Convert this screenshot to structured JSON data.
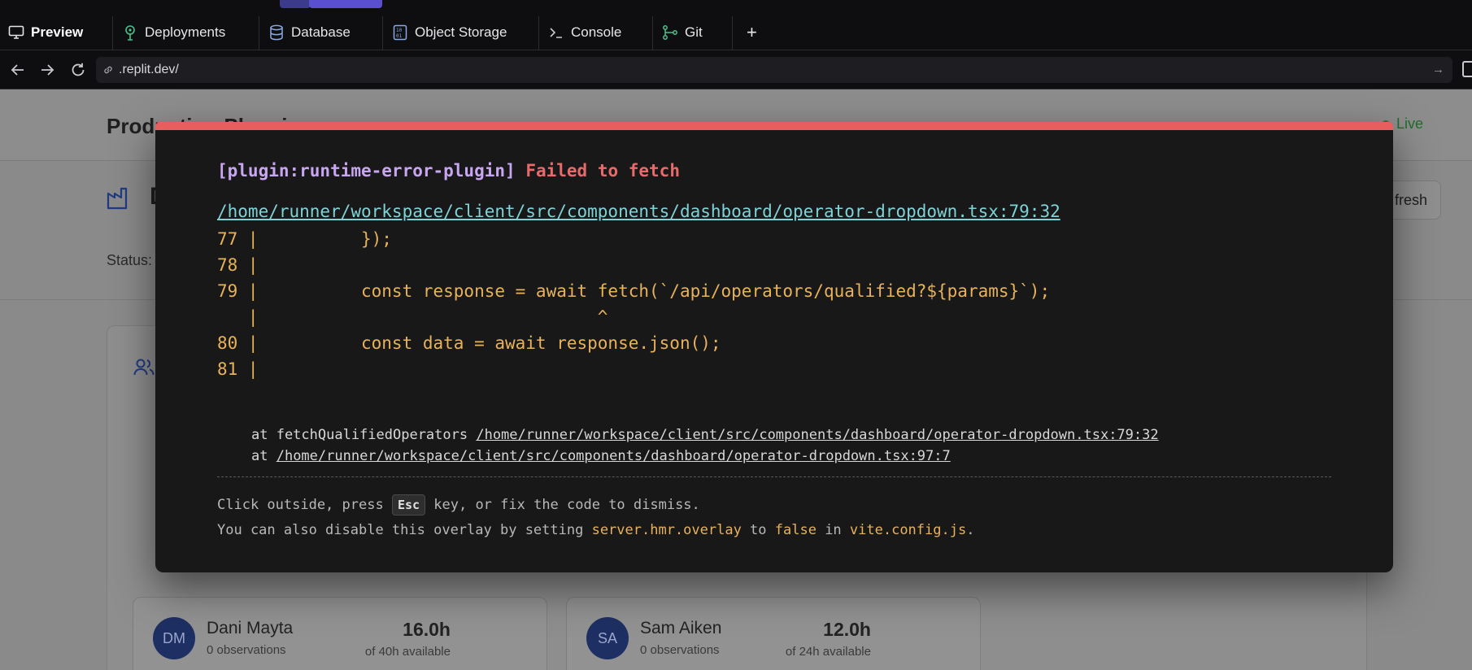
{
  "tabs": [
    {
      "label": "Preview",
      "icon": "monitor-icon",
      "active": true
    },
    {
      "label": "Deployments",
      "icon": "deploy-icon"
    },
    {
      "label": "Database",
      "icon": "database-icon"
    },
    {
      "label": "Object Storage",
      "icon": "storage-icon"
    },
    {
      "label": "Console",
      "icon": "terminal-icon"
    },
    {
      "label": "Git",
      "icon": "git-icon"
    }
  ],
  "add_tab_label": "+",
  "url": ".replit.dev/",
  "app": {
    "brand": "Production Planning",
    "page_title_stub": "D",
    "refresh_label": "fresh",
    "status_label": "Status:",
    "live_label": "Live",
    "operators": [
      {
        "initials": "DM",
        "name": "Dani Mayta",
        "observations": "0 observations",
        "hours": "16.0h",
        "available": "of 40h available"
      },
      {
        "initials": "SA",
        "name": "Sam Aiken",
        "observations": "0 observations",
        "hours": "12.0h",
        "available": "of 24h available"
      }
    ]
  },
  "error": {
    "plugin": "[plugin:runtime-error-plugin]",
    "message": "Failed to fetch",
    "file": "/home/runner/workspace/client/src/components/dashboard/operator-dropdown.tsx:79:32",
    "code_lines": [
      "77 |          });",
      "78 |",
      "79 |          const response = await fetch(`/api/operators/qualified?${params}`);",
      "   |                                 ^",
      "80 |          const data = await response.json();",
      "81 |"
    ],
    "stack": [
      {
        "prefix": "at fetchQualifiedOperators ",
        "link": "/home/runner/workspace/client/src/components/dashboard/operator-dropdown.tsx:79:32"
      },
      {
        "prefix": "at ",
        "link": "/home/runner/workspace/client/src/components/dashboard/operator-dropdown.tsx:97:7"
      }
    ],
    "tip_line1_a": "Click outside, press ",
    "tip_key": "Esc",
    "tip_line1_b": " key, or fix the code to dismiss.",
    "tip_line2_a": "You can also disable this overlay by setting ",
    "tip_setting": "server.hmr.overlay",
    "tip_line2_b": " to ",
    "tip_value": "false",
    "tip_line2_c": " in ",
    "tip_file": "vite.config.js",
    "tip_line2_d": "."
  }
}
